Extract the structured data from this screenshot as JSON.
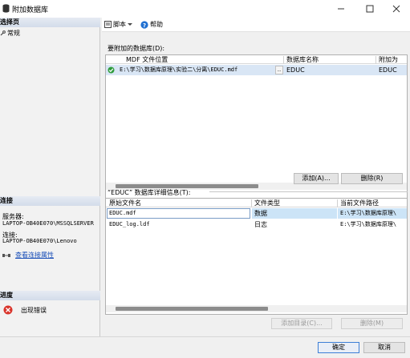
{
  "window": {
    "title": "附加数据库",
    "controls": [
      "minimize-icon",
      "maximize-icon",
      "close-icon"
    ]
  },
  "left": {
    "select_page": {
      "header": "选择页",
      "items": [
        {
          "label": "常规",
          "icon": "wrench-icon"
        }
      ]
    },
    "connection": {
      "header": "连接",
      "server_label": "服务器:",
      "server_value": "LAPTOP-OB40E070\\MSSQLSERVER",
      "conn_label": "连接:",
      "conn_value": "LAPTOP-OB40E070\\Lenovo",
      "link": "查看连接属性"
    },
    "progress": {
      "header": "进度",
      "status": "出现错误"
    }
  },
  "toolbar": {
    "script": "脚本",
    "help": "帮助"
  },
  "attach": {
    "label": "要附加的数据库(D):",
    "columns": [
      "MDF 文件位置",
      "数据库名称",
      "附加为"
    ],
    "rows": [
      {
        "status": "ok",
        "mdf": "E:\\学习\\数据库原理\\实验二\\分离\\EDUC.mdf",
        "browse": "..",
        "dbname": "EDUC",
        "attach_as": "EDUC"
      }
    ],
    "add_btn": "添加(A)...",
    "remove_btn": "删除(R)"
  },
  "details": {
    "label": "“EDUC” 数据库详细信息(T):",
    "columns": [
      "原始文件名",
      "文件类型",
      "当前文件路径"
    ],
    "rows": [
      {
        "name": "EDUC.mdf",
        "type": "数据",
        "path": "E:\\学习\\数据库原理\\"
      },
      {
        "name": "EDUC_log.ldf",
        "type": "日志",
        "path": "E:\\学习\\数据库原理\\"
      }
    ],
    "add_catalog_btn": "添加目录(C)...",
    "remove_btn": "删除(M)"
  },
  "footer": {
    "ok": "确定",
    "cancel": "取消"
  },
  "colors": {
    "selection": "#cce4f7",
    "section_header": "#dbe3ef",
    "link": "#1a4fb8",
    "error": "#d9342b"
  }
}
